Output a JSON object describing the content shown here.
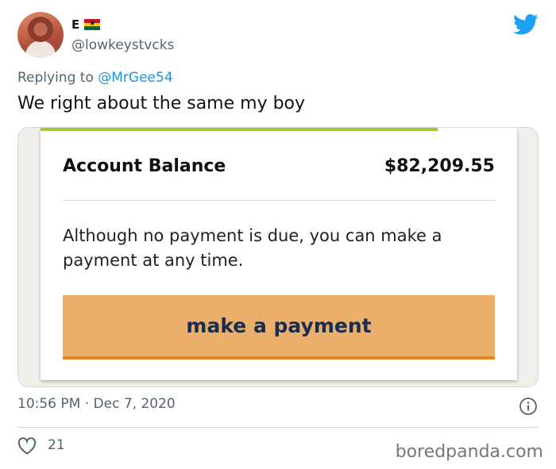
{
  "author": {
    "display_name": "E",
    "handle": "@lowkeystvcks"
  },
  "reply": {
    "prefix": "Replying to ",
    "mention": "@MrGee54"
  },
  "tweet": {
    "text": "We right about the same my boy",
    "timestamp": "10:56 PM · Dec 7, 2020",
    "likes": "21"
  },
  "media": {
    "balance_label": "Account Balance",
    "balance_value": "$82,209.55",
    "note": "Although no payment is due, you can make a payment at any time.",
    "button_label": "make a payment"
  },
  "watermark": "boredpanda.com",
  "icons": {
    "brand": "twitter-bird-icon",
    "flag": "ghana-flag-icon",
    "info": "info-icon",
    "like": "heart-icon"
  },
  "colors": {
    "twitter_blue": "#1da1f2",
    "mention_blue": "#1b95e0",
    "button_fill": "#eaaf6a",
    "button_underline": "#e5871c",
    "accent_line": "#a9c23f"
  }
}
